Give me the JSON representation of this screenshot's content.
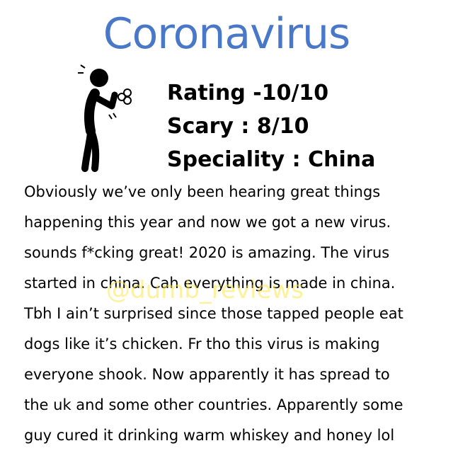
{
  "header": {
    "title": "Coronavirus",
    "title_color": "#4a78c8"
  },
  "illustration": {
    "icon": "coughing-person-icon"
  },
  "stats": {
    "rating": "Rating -10/10",
    "scary": "Scary : 8/10",
    "speciality": "Speciality : China"
  },
  "review": {
    "lines": [
      "Obviously we’ve only been hearing great things",
      "happening this year and now we got a new virus.",
      "sounds f*cking great! 2020 is amazing. The virus",
      "started in china. Cah everything is made in china.",
      "Tbh I ain’t surprised since those tapped people eat",
      "dogs like it’s chicken. Fr tho this virus is making",
      "everyone shook. Now apparently it has spread to",
      "the uk and some other countries. Apparently some",
      "guy cured it drinking warm whiskey and honey lol"
    ]
  },
  "watermark": {
    "text": "@dumb_reviews",
    "color": "#ffe64a"
  }
}
